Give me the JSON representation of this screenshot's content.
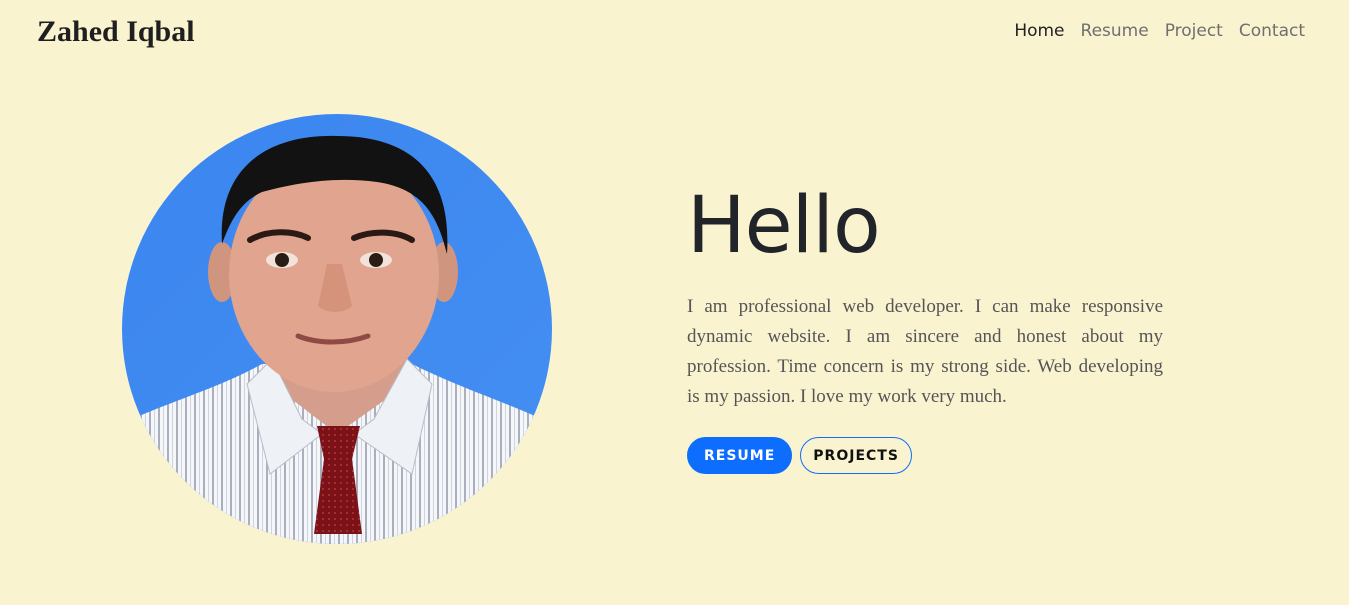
{
  "header": {
    "brand": "Zahed Iqbal",
    "nav": [
      {
        "label": "Home",
        "active": true
      },
      {
        "label": "Resume",
        "active": false
      },
      {
        "label": "Project",
        "active": false
      },
      {
        "label": "Contact",
        "active": false
      }
    ]
  },
  "hero": {
    "heading": "Hello",
    "paragraph": "I am professional web developer. I can make responsive dynamic website. I am sincere and honest about my profession. Time concern is my strong side. Web developing is my passion. I love my work very much.",
    "buttons": {
      "resume": "RESUME",
      "projects": "PROJECTS"
    }
  },
  "colors": {
    "page_background": "#faf3d0",
    "primary": "#0d6efd",
    "photo_background": "#3f8cf0"
  }
}
